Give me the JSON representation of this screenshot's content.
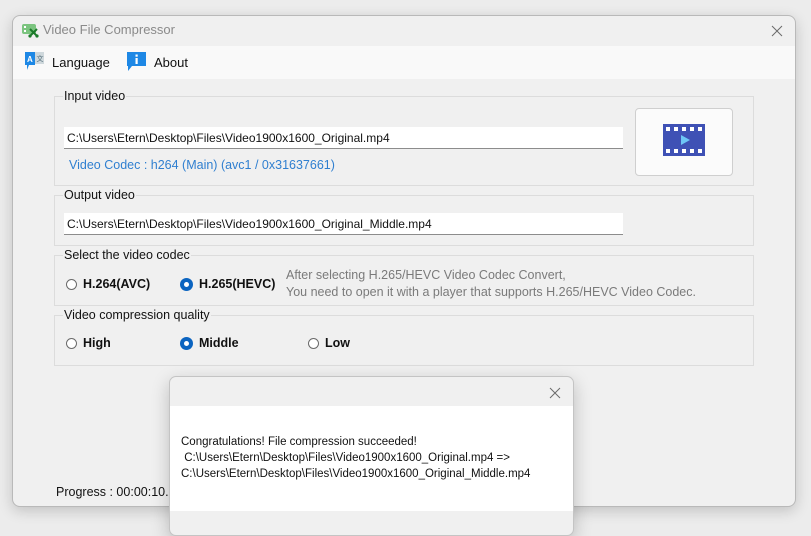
{
  "window": {
    "title": "Video File Compressor",
    "icon": "video-scissors-icon"
  },
  "menu": {
    "items": [
      {
        "label": "Language",
        "icon": "language-icon"
      },
      {
        "label": "About",
        "icon": "info-icon"
      }
    ]
  },
  "input_video": {
    "group_label": "Input video",
    "path": "C:\\Users\\Etern\\Desktop\\Files\\Video1900x1600_Original.mp4",
    "codec_info": "Video Codec : h264 (Main) (avc1 / 0x31637661)",
    "browse_icon": "film-play-icon"
  },
  "output_video": {
    "group_label": "Output video",
    "path": "C:\\Users\\Etern\\Desktop\\Files\\Video1900x1600_Original_Middle.mp4"
  },
  "codec": {
    "group_label": "Select the video codec",
    "options": [
      {
        "label": "H.264(AVC)",
        "checked": false
      },
      {
        "label": "H.265(HEVC)",
        "checked": true
      }
    ],
    "hint_line1": "After selecting H.265/HEVC Video Codec Convert,",
    "hint_line2": "You need to open it with a player that supports H.265/HEVC Video Codec."
  },
  "quality": {
    "group_label": "Video compression quality",
    "options": [
      {
        "label": "High",
        "checked": false
      },
      {
        "label": "Middle",
        "checked": true
      },
      {
        "label": "Low",
        "checked": false
      }
    ]
  },
  "progress": {
    "text": "Progress : 00:00:10."
  },
  "dialog": {
    "message": "Congratulations! File compression succeeded!\n C:\\Users\\Etern\\Desktop\\Files\\Video1900x1600_Original.mp4 =>\nC:\\Users\\Etern\\Desktop\\Files\\Video1900x1600_Original_Middle.mp4"
  },
  "colors": {
    "accent": "#0b64c0",
    "codec_info": "#2f7fd0",
    "film_icon": "#3f51b5",
    "film_play": "#6ec6f5",
    "info_icon": "#1e88e5"
  }
}
